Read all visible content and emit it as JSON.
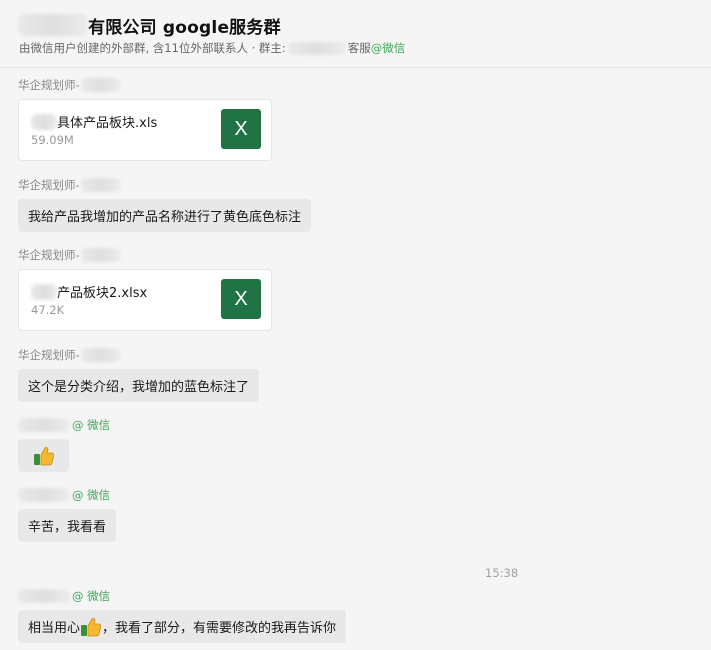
{
  "header": {
    "title": "有限公司 google服务群",
    "subtitle_prefix": "由微信用户创建的外部群, 含11位外部联系人 · 群主:",
    "subtitle_suffix": "客服",
    "subtitle_wechat": "@微信"
  },
  "messages": [
    {
      "sender": "华企规划师-",
      "type": "file",
      "file_name": "具体产品板块.xls",
      "file_size": "59.09M",
      "file_icon": "X"
    },
    {
      "sender": "华企规划师-",
      "type": "text",
      "text": "我给产品我增加的产品名称进行了黄色底色标注"
    },
    {
      "sender": "华企规划师-",
      "type": "file",
      "file_name": "产品板块2.xlsx",
      "file_size": "47.2K",
      "file_icon": "X"
    },
    {
      "sender": "华企规划师-",
      "type": "text",
      "text": "这个是分类介绍，我增加的蓝色标注了"
    },
    {
      "sender_suffix": "@ 微信",
      "type": "emoji",
      "emoji": "thumbs-up"
    },
    {
      "sender_suffix": "@ 微信",
      "type": "text",
      "text": "辛苦，我看看"
    },
    {
      "sender_suffix": "@ 微信",
      "type": "text",
      "text_before": "相当用心",
      "text_after": "，我看了部分，有需要修改的我再告诉你"
    }
  ],
  "timestamp": "15:38",
  "colors": {
    "wechat_green": "#3fa757",
    "excel_green": "#207345",
    "bubble_gray": "#e8e8e8"
  }
}
